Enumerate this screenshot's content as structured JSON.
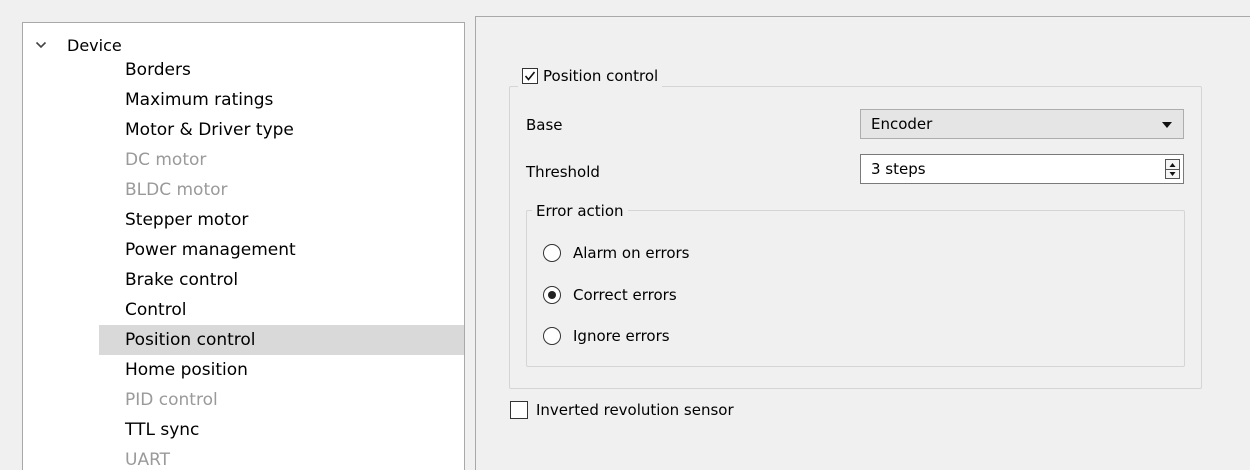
{
  "tree": {
    "root_label": "Device",
    "items": [
      {
        "label": "Borders",
        "disabled": false,
        "selected": false
      },
      {
        "label": "Maximum ratings",
        "disabled": false,
        "selected": false
      },
      {
        "label": "Motor & Driver type",
        "disabled": false,
        "selected": false
      },
      {
        "label": "DC motor",
        "disabled": true,
        "selected": false
      },
      {
        "label": "BLDC motor",
        "disabled": true,
        "selected": false
      },
      {
        "label": "Stepper motor",
        "disabled": false,
        "selected": false
      },
      {
        "label": "Power management",
        "disabled": false,
        "selected": false
      },
      {
        "label": "Brake control",
        "disabled": false,
        "selected": false
      },
      {
        "label": "Control",
        "disabled": false,
        "selected": false
      },
      {
        "label": "Position control",
        "disabled": false,
        "selected": true
      },
      {
        "label": "Home position",
        "disabled": false,
        "selected": false
      },
      {
        "label": "PID control",
        "disabled": true,
        "selected": false
      },
      {
        "label": "TTL sync",
        "disabled": false,
        "selected": false
      },
      {
        "label": "UART",
        "disabled": true,
        "selected": false
      }
    ]
  },
  "position_control": {
    "enable_label": "Position control",
    "enabled": true,
    "base_label": "Base",
    "base_value": "Encoder",
    "threshold_label": "Threshold",
    "threshold_value": "3 steps",
    "error_action": {
      "title": "Error action",
      "options": [
        {
          "label": "Alarm on errors",
          "checked": false
        },
        {
          "label": "Correct errors",
          "checked": true
        },
        {
          "label": "Ignore errors",
          "checked": false
        }
      ]
    }
  },
  "inverted_sensor": {
    "label": "Inverted revolution sensor",
    "checked": false
  },
  "colors": {
    "selected_bg": "#d9d9d9",
    "disabled_text": "#9a9a9a",
    "panel_bg": "#f0f0f0"
  }
}
